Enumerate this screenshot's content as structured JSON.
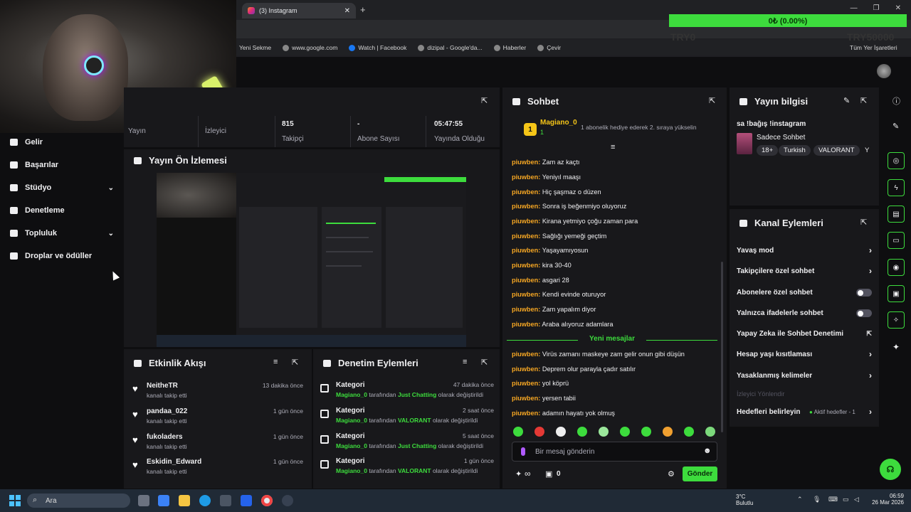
{
  "browser": {
    "tab_title": "(3) Instagram",
    "bookmarks": [
      "Yeni Sekme",
      "www.google.com",
      "Watch | Facebook",
      "dizipal - Google'da...",
      "Haberler",
      "Çevir"
    ],
    "all_bookmarks": "Tüm Yer İşaretleri"
  },
  "overlay": {
    "goal_text": "0₺ (0.00%)",
    "left": "TRY0",
    "right": "TRY50000",
    "progress": 0.0
  },
  "nav": {
    "items": [
      {
        "label": "Gelir"
      },
      {
        "label": "Başarılar"
      },
      {
        "label": "Stüdyo",
        "expand": true
      },
      {
        "label": "Denetleme"
      },
      {
        "label": "Topluluk",
        "expand": true
      },
      {
        "label": "Droplar ve ödüller"
      }
    ]
  },
  "stats": {
    "items": [
      {
        "value": "",
        "label": "Yayın"
      },
      {
        "value": "",
        "label": "İzleyici"
      },
      {
        "value": "815",
        "label": "Takipçi"
      },
      {
        "value": "-",
        "label": "Abone Sayısı"
      },
      {
        "value": "05:47:55",
        "label": "Yayında Olduğu"
      }
    ]
  },
  "preview": {
    "title": "Yayın Ön İzlemesi"
  },
  "activity": {
    "title": "Etkinlik Akışı",
    "events": [
      {
        "name": "NeitheTR",
        "sub": "kanalı takip etti",
        "time": "13 dakika önce"
      },
      {
        "name": "pandaa_022",
        "sub": "kanalı takip etti",
        "time": "1 gün önce"
      },
      {
        "name": "fukoladers",
        "sub": "kanalı takip etti",
        "time": "1 gün önce"
      },
      {
        "name": "Eskidin_Edward",
        "sub": "kanalı takip etti",
        "time": "1 gün önce"
      }
    ]
  },
  "mod": {
    "title": "Denetim Eylemleri",
    "actions": [
      {
        "title": "Kategori",
        "user": "Magiano_0",
        "mid": "tarafından",
        "cat": "Just Chatting",
        "end": "olarak değiştirildi",
        "time": "47 dakika önce"
      },
      {
        "title": "Kategori",
        "user": "Magiano_0",
        "mid": "tarafından",
        "cat": "VALORANT",
        "end": "olarak değiştirildi",
        "time": "2 saat önce"
      },
      {
        "title": "Kategori",
        "user": "Magiano_0",
        "mid": "tarafından",
        "cat": "Just Chatting",
        "end": "olarak değiştirildi",
        "time": "5 saat önce"
      },
      {
        "title": "Kategori",
        "user": "Magiano_0",
        "mid": "tarafından",
        "cat": "VALORANT",
        "end": "olarak değiştirildi",
        "time": "1 gün önce"
      }
    ]
  },
  "chat": {
    "title": "Sohbet",
    "pinned_user": "Magiano_0",
    "pinned_count": "1",
    "pinned_text": "1 abonelik hediye ederek 2. sıraya yükselin",
    "rank": "1",
    "messages": [
      {
        "user": "piuwben:",
        "text": "Zam az kaçtı"
      },
      {
        "user": "piuwben:",
        "text": "Yeniyıl maaşı"
      },
      {
        "user": "piuwben:",
        "text": "Hiç şaşmaz o düzen"
      },
      {
        "user": "piuwben:",
        "text": "Sonra iş beğenmiyo oluyoruz"
      },
      {
        "user": "piuwben:",
        "text": "Kirana yetmiyo çoğu zaman para"
      },
      {
        "user": "piuwben:",
        "text": "Sağlığı yemeği geçtim"
      },
      {
        "user": "piuwben:",
        "text": "Yaşayamıyosun"
      },
      {
        "user": "piuwben:",
        "text": "kira 30-40"
      },
      {
        "user": "piuwben:",
        "text": "asgari 28"
      },
      {
        "user": "piuwben:",
        "text": "Kendi evinde oturuyor"
      },
      {
        "user": "piuwben:",
        "text": "Zam yapalım diyor"
      },
      {
        "user": "piuwben:",
        "text": "Araba alıyoruz adamlara"
      }
    ],
    "new_label": "Yeni mesajlar",
    "new_messages": [
      {
        "user": "piuwben:",
        "text": "Virüs zamanı maskeye zam gelir onun gibi düşün"
      },
      {
        "user": "piuwben:",
        "text": "Deprem olur parayla çadır satılır"
      },
      {
        "user": "piuwben:",
        "text": "yol köprü"
      },
      {
        "user": "piuwben:",
        "text": "yersen tabii"
      },
      {
        "user": "piuwben:",
        "text": "adamın hayatı yok olmuş"
      }
    ],
    "placeholder": "Bir mesaj gönderin",
    "infinity": "∞",
    "points": "0",
    "send": "Gönder"
  },
  "stream_info": {
    "title": "Yayın bilgisi",
    "stream_title": "sa !bağış !instagram",
    "category": "Sadece Sohbet",
    "tags": [
      "18+",
      "Turkish",
      "VALORANT",
      "Y"
    ]
  },
  "channel_actions": {
    "title": "Kanal Eylemleri",
    "items": [
      {
        "label": "Yavaş mod",
        "kind": "arrow"
      },
      {
        "label": "Takipçilere özel sohbet",
        "kind": "arrow"
      },
      {
        "label": "Abonelere özel sohbet",
        "kind": "toggle"
      },
      {
        "label": "Yalnızca ifadelerle sohbet",
        "kind": "toggle"
      },
      {
        "label": "Yapay Zeka ile Sohbet Denetimi",
        "kind": "external"
      },
      {
        "label": "Hesap yaşı kısıtlaması",
        "kind": "arrow"
      },
      {
        "label": "Yasaklanmış kelimeler",
        "kind": "arrow"
      }
    ],
    "section_label": "İzleyici Yönlendir",
    "goals_label": "Hedefleri belirleyin",
    "goals_status": "Aktif hedefler - 1"
  },
  "taskbar": {
    "search": "Ara",
    "weather_temp": "3°C",
    "weather_desc": "Bulutlu",
    "time": "06:59",
    "date": "26 Mar 2026"
  },
  "colors": {
    "accent": "#3ddc3d",
    "username": "#f5a623",
    "panel": "#18181b",
    "background": "#0e0e10"
  }
}
